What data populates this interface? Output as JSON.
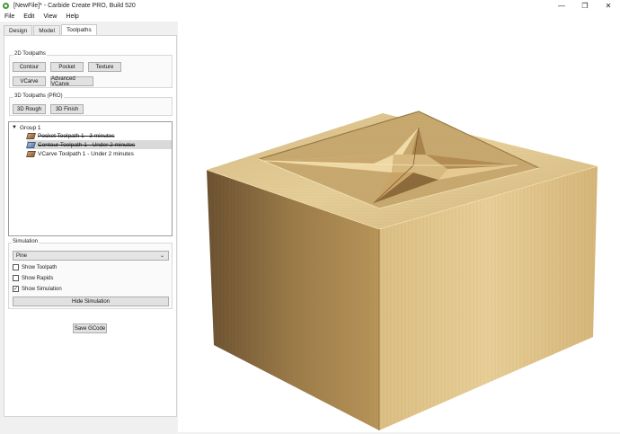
{
  "window": {
    "title": "[NewFile]* - Carbide Create PRO, Build 520",
    "minimize_glyph": "—",
    "maximize_glyph": "❐",
    "close_glyph": "✕"
  },
  "menu": [
    "File",
    "Edit",
    "View",
    "Help"
  ],
  "tabs": [
    {
      "label": "Design",
      "active": false
    },
    {
      "label": "Model",
      "active": false
    },
    {
      "label": "Toolpaths",
      "active": true
    }
  ],
  "toolpaths_2d": {
    "title": "2D Toolpaths",
    "buttons": [
      "Contour",
      "Pocket",
      "Texture",
      "VCarve",
      "Advanced VCarve"
    ]
  },
  "toolpaths_3d": {
    "title": "3D Toolpaths (PRO)",
    "buttons": [
      "3D Rough",
      "3D Finish"
    ]
  },
  "tree": {
    "group_label": "Group 1",
    "items": [
      {
        "label": "Pocket Toolpath 1 - 3 minutes",
        "disabled": true,
        "selected": false,
        "icon": "pocket-toolpath-icon"
      },
      {
        "label": "Contour Toolpath 1 - Under 2 minutes",
        "disabled": true,
        "selected": true,
        "icon": "contour-toolpath-icon"
      },
      {
        "label": "VCarve Toolpath 1 - Under 2 minutes",
        "disabled": false,
        "selected": false,
        "icon": "vcarve-toolpath-icon"
      }
    ]
  },
  "simulation": {
    "title": "Simulation",
    "material": "Pine",
    "checks": [
      {
        "label": "Show Toolpath",
        "checked": false
      },
      {
        "label": "Show Rapids",
        "checked": false
      },
      {
        "label": "Show Simulation",
        "checked": true
      }
    ],
    "hide_button": "Hide Simulation"
  },
  "save_button": "Save GCode"
}
